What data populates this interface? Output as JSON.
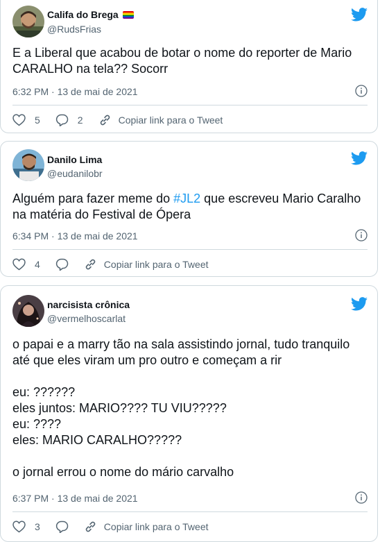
{
  "colors": {
    "accent": "#1d9bf0",
    "text": "#0f1419",
    "muted": "#536471",
    "border": "#cfd9de"
  },
  "tweets": [
    {
      "name": "Califa do Brega",
      "name_emoji": "rainbow-flag",
      "handle": "@RudsFrias",
      "text": "E a Liberal que acabou de botar o nome do reporter de Mario CARALHO na tela?? Socorr",
      "timestamp": "6:32 PM · 13 de mai de 2021",
      "likes": "5",
      "replies": "2",
      "copy_link": "Copiar link para o Tweet"
    },
    {
      "name": "Danilo Lima",
      "handle": "@eudanilobr",
      "text_before": "Alguém para fazer meme do ",
      "hashtag": "#JL2",
      "text_after": " que escreveu Mario Caralho na matéria do Festival de Ópera",
      "timestamp": "6:34 PM · 13 de mai de 2021",
      "likes": "4",
      "copy_link": "Copiar link para o Tweet"
    },
    {
      "name": "narcisista crônica",
      "handle": "@vermelhoscarlat",
      "text": "o papai e a marry tão na sala assistindo jornal, tudo tranquilo até que eles viram um pro outro e começam a rir\n\neu: ??????\neles juntos: MARIO???? TU VIU?????\neu: ????\neles: MARIO CARALHO?????\n\no jornal errou o nome do mário carvalho",
      "timestamp": "6:37 PM · 13 de mai de 2021",
      "likes": "3",
      "copy_link": "Copiar link para o Tweet"
    }
  ]
}
